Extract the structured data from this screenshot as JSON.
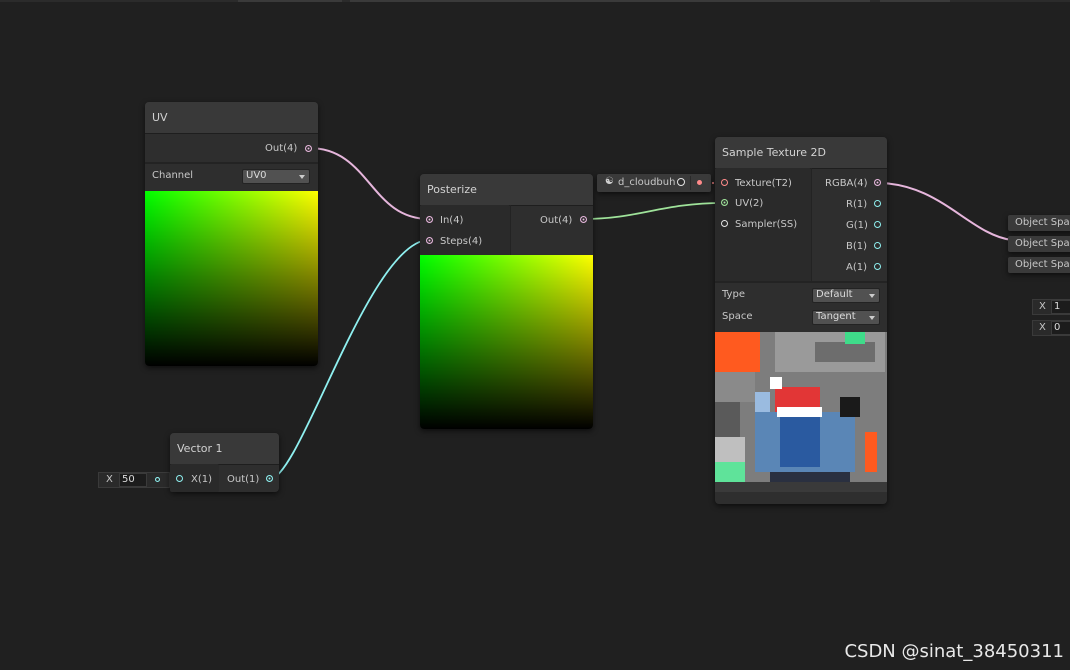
{
  "uv_node": {
    "title": "UV",
    "out_label": "Out(4)",
    "channel_label": "Channel",
    "channel_value": "UV0"
  },
  "posterize_node": {
    "title": "Posterize",
    "in_label": "In(4)",
    "steps_label": "Steps(4)",
    "out_label": "Out(4)"
  },
  "vector1_node": {
    "title": "Vector 1",
    "x_label": "X(1)",
    "out_label": "Out(1)",
    "inline_axis": "X",
    "inline_value": "50"
  },
  "texture_property": {
    "name": "d_cloudbuh"
  },
  "sample_node": {
    "title": "Sample Texture 2D",
    "inputs": [
      "Texture(T2)",
      "UV(2)",
      "Sampler(SS)"
    ],
    "outputs": [
      "RGBA(4)",
      "R(1)",
      "G(1)",
      "B(1)",
      "A(1)"
    ],
    "type_label": "Type",
    "type_value": "Default",
    "space_label": "Space",
    "space_value": "Tangent"
  },
  "right_offscreen": {
    "items": [
      "Object Spa",
      "Object Spa",
      "Object Spa"
    ],
    "fields": [
      {
        "axis": "X",
        "value": "1"
      },
      {
        "axis": "X",
        "value": "0"
      }
    ]
  },
  "watermark": "CSDN @sinat_38450311",
  "colors": {
    "vector4_port": "#e6b6dc",
    "vector1_port": "#8ff0f0",
    "vector2_port": "#9fe39a",
    "texture_port": "#ff8a8a",
    "canvas": "#202020"
  }
}
